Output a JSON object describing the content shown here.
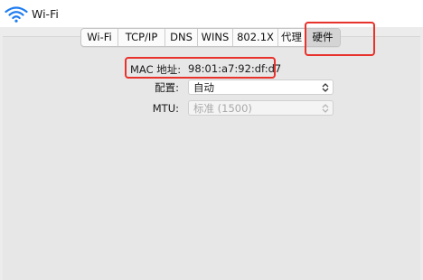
{
  "window": {
    "title": "Wi-Fi",
    "icon": "wifi-icon"
  },
  "tabs": [
    {
      "label": "Wi-Fi"
    },
    {
      "label": "TCP/IP"
    },
    {
      "label": "DNS"
    },
    {
      "label": "WINS"
    },
    {
      "label": "802.1X"
    },
    {
      "label": "代理"
    },
    {
      "label": "硬件"
    }
  ],
  "active_tab": "硬件",
  "hardware": {
    "mac_label": "MAC 地址:",
    "mac_value": "98:01:a7:92:df:d7",
    "config_label": "配置:",
    "config_value": "自动",
    "mtu_label": "MTU:",
    "mtu_value": "标准 (1500)"
  },
  "colors": {
    "highlight": "#e8322c",
    "disabled_text": "#a9a9a9"
  }
}
